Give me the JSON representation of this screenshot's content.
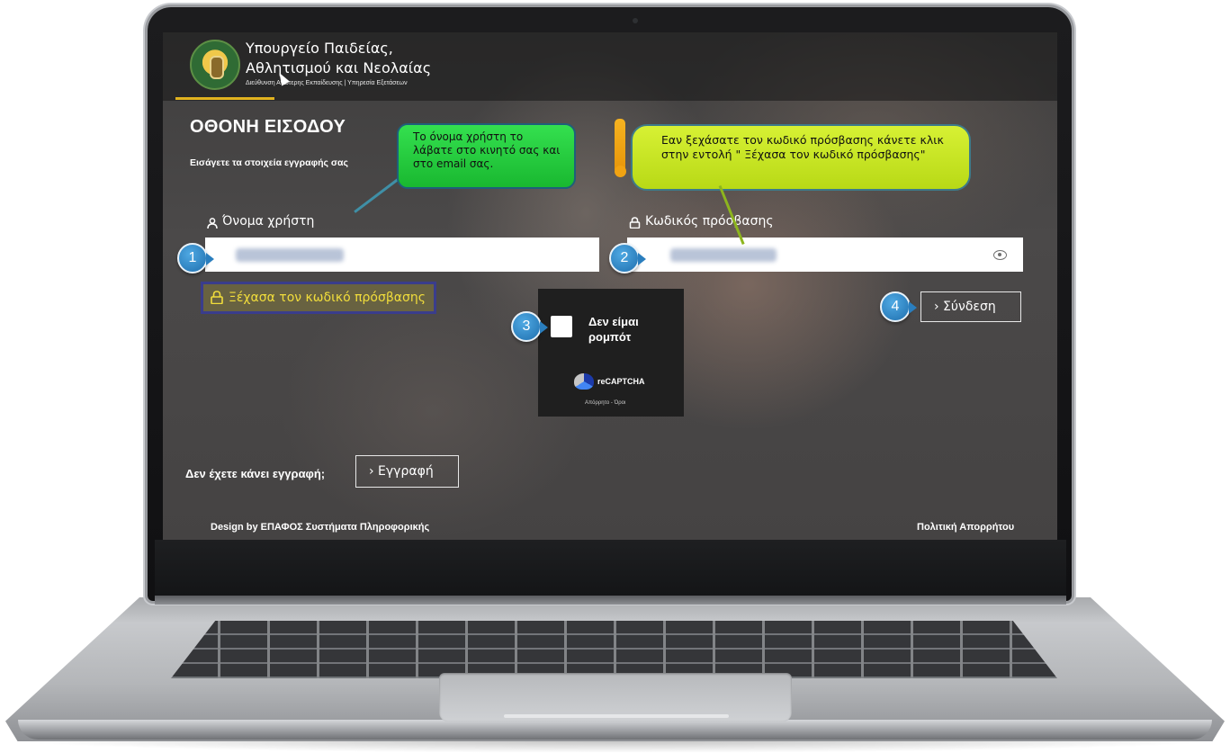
{
  "header": {
    "ministry_line1": "Υπουργείο Παιδείας,",
    "ministry_line2": "Αθλητισμού και Νεολαίας",
    "ministry_subline": "Διεύθυνση Ανώτερης Εκπαίδευσης | Υπηρεσία Εξετάσεων"
  },
  "login": {
    "title": "ΟΘΟΝΗ ΕΙΣΟΔΟΥ",
    "subtitle": "Εισάγετε τα στοιχεία εγγραφής σας",
    "username_label": "Όνομα χρήστη",
    "password_label": "Κωδικός πρόσβασης",
    "forgot_password": "Ξέχασα τον κωδικό πρόσβασης",
    "login_button": "› Σύνδεση"
  },
  "captcha": {
    "label": "Δεν είμαι ρομπότ",
    "brand": "reCAPTCHA",
    "links": "Απόρρητο - Όροι"
  },
  "register": {
    "prompt": "Δεν έχετε κάνει εγγραφή;",
    "button": "› Εγγραφή"
  },
  "footer": {
    "design": "Design by ΕΠΑΦΟΣ Συστήματα Πληροφορικής",
    "privacy": "Πολιτική Απορρήτου"
  },
  "callouts": {
    "username_tip": "Το όνομα χρήστη το λάβατε στο κινητό σας και στο email σας.",
    "password_tip": "Εαν ξεχάσατε τον κωδικό πρόσβασης κάνετε κλικ στην εντολή \" Ξέχασα τον κωδικό πρόσβασης\""
  },
  "steps": [
    "1",
    "2",
    "3",
    "4"
  ],
  "colors": {
    "accent_yellow": "#e1b21f",
    "forgot_text": "#f1dd3b",
    "callout_green": "#19b830",
    "callout_yellow": "#b8d916",
    "step_badge": "#1f6fae"
  }
}
